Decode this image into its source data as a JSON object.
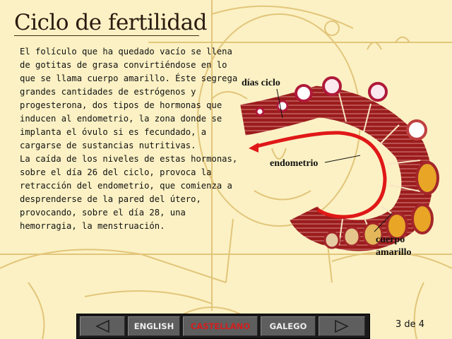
{
  "title": "Ciclo de fertilidad",
  "body_paragraphs": [
    "El folículo que ha quedado vacío se llena\nde gotitas de grasa convirtiéndose en lo\nque se llama cuerpo amarillo. Éste segrega\ngrandes cantidades de estrógenos y\nprogesterona, dos tipos de hormonas que\ninducen al endometrio, la zona donde se\nimplanta el óvulo si es fecundado, a\ncargarse de sustancias nutritivas.",
    "La caída de los niveles de estas hormonas,\nsobre el día 26 del ciclo, provoca la\nretracción del endometrio, que comienza a\ndesprenderse de la pared del útero,\nprovocando, sobre el día 28, una\nhemorragia, la menstruación."
  ],
  "diagram": {
    "label_days": "días ciclo",
    "label_endometrium": "endometrio",
    "label_corpus_line1": "cuerpo",
    "label_corpus_line2": "amarillo"
  },
  "nav": {
    "prev_icon": "triangle-left-icon",
    "next_icon": "triangle-right-icon",
    "languages": [
      "ENGLISH",
      "CASTELLANO",
      "GALEGO"
    ],
    "active_language": "CASTELLANO",
    "page_indicator": "3 de 4"
  },
  "colors": {
    "background": "#fbf1c4",
    "sketch": "#e2c57a",
    "endometrium": "#8b1a1a",
    "arrow": "#e01818",
    "active_language": "#d21e1e",
    "button": "#5e5e5e"
  }
}
